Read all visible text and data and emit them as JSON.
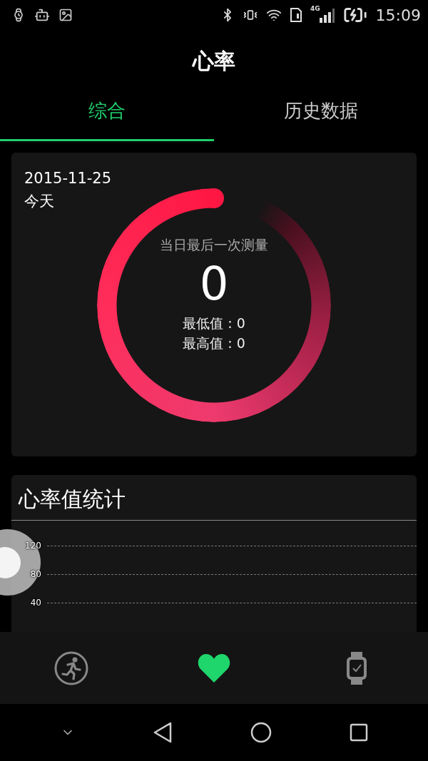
{
  "status_bar": {
    "time": "15:09",
    "network": "4G"
  },
  "title": "心率",
  "tabs": [
    {
      "label": "综合",
      "selected": true
    },
    {
      "label": "历史数据",
      "selected": false
    }
  ],
  "summary": {
    "date": "2015-11-25",
    "day": "今天",
    "caption": "当日最后一次测量",
    "value": "0",
    "min": "最低值 : 0",
    "max": "最高值 : 0"
  },
  "stats": {
    "title": "心率值统计",
    "y_ticks": [
      "120",
      "80",
      "40"
    ]
  },
  "bottom_nav": [
    {
      "kind": "run",
      "selected": false
    },
    {
      "kind": "heart",
      "selected": true
    },
    {
      "kind": "watch",
      "selected": false
    }
  ]
}
